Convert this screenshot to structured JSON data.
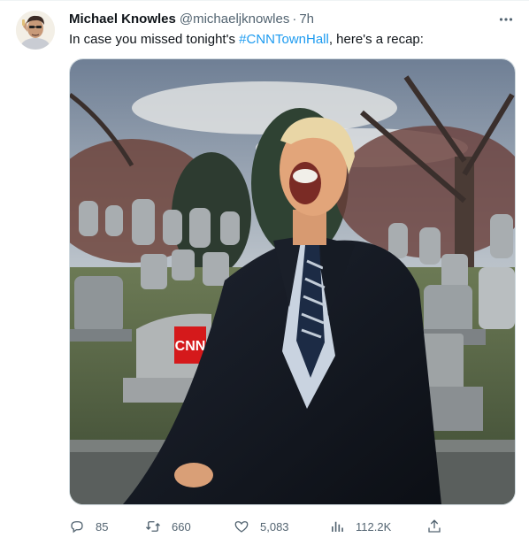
{
  "tweet": {
    "author": {
      "display_name": "Michael Knowles",
      "handle": "@michaeljknowles",
      "separator": "·",
      "time": "7h",
      "avatar_icon": "avatar-portrait"
    },
    "text": {
      "prefix": "In case you missed tonight's ",
      "hashtag": "#CNNTownHall",
      "suffix": ", here's a recap:"
    },
    "media": {
      "logo_text": "CNN"
    },
    "actions": {
      "reply": {
        "icon": "reply-icon",
        "count": "85"
      },
      "retweet": {
        "icon": "retweet-icon",
        "count": "660"
      },
      "like": {
        "icon": "heart-icon",
        "count": "5,083"
      },
      "views": {
        "icon": "views-icon",
        "count": "112.2K"
      },
      "share": {
        "icon": "share-icon"
      }
    }
  },
  "colors": {
    "accent": "#1d9bf0",
    "text_primary": "#0f1419",
    "text_secondary": "#536471",
    "border": "#cfd9de"
  }
}
